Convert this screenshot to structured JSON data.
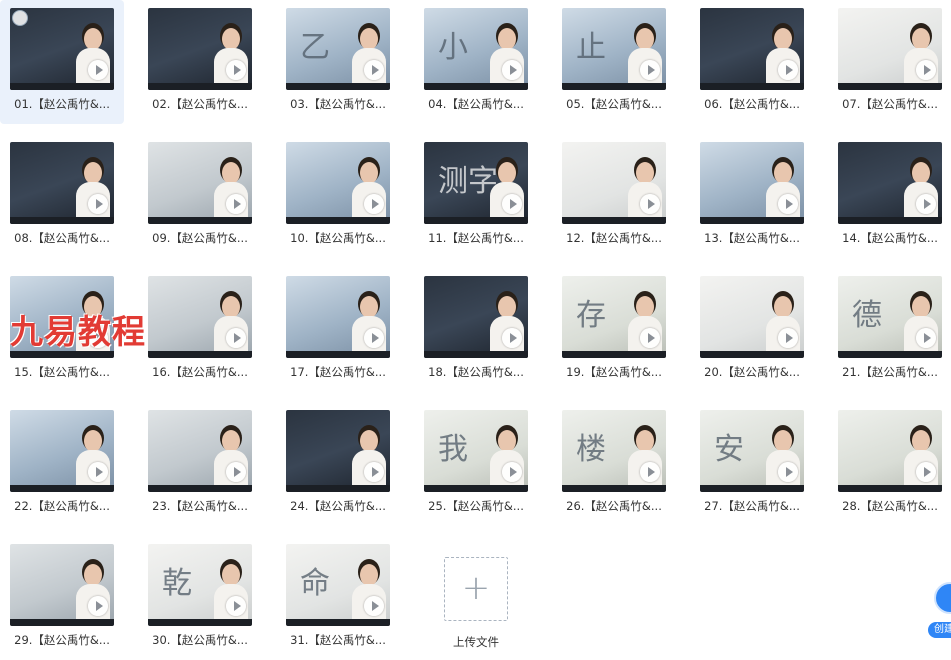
{
  "files": [
    {
      "label": "01.【赵公禹竹&...",
      "style": "dark",
      "glyph": "",
      "selected": true
    },
    {
      "label": "02.【赵公禹竹&...",
      "style": "dark",
      "glyph": ""
    },
    {
      "label": "03.【赵公禹竹&...",
      "style": "blue",
      "glyph": "乙"
    },
    {
      "label": "04.【赵公禹竹&...",
      "style": "blue",
      "glyph": "小"
    },
    {
      "label": "05.【赵公禹竹&...",
      "style": "blue",
      "glyph": "止"
    },
    {
      "label": "06.【赵公禹竹&...",
      "style": "dark",
      "glyph": ""
    },
    {
      "label": "07.【赵公禹竹&...",
      "style": "white",
      "glyph": ""
    },
    {
      "label": "08.【赵公禹竹&...",
      "style": "dark",
      "glyph": ""
    },
    {
      "label": "09.【赵公禹竹&...",
      "style": "grey",
      "glyph": ""
    },
    {
      "label": "10.【赵公禹竹&...",
      "style": "blue",
      "glyph": ""
    },
    {
      "label": "11.【赵公禹竹&...",
      "style": "dark",
      "glyph": "测字"
    },
    {
      "label": "12.【赵公禹竹&...",
      "style": "white",
      "glyph": ""
    },
    {
      "label": "13.【赵公禹竹&...",
      "style": "blue",
      "glyph": ""
    },
    {
      "label": "14.【赵公禹竹&...",
      "style": "dark",
      "glyph": ""
    },
    {
      "label": "15.【赵公禹竹&...",
      "style": "blue",
      "glyph": ""
    },
    {
      "label": "16.【赵公禹竹&...",
      "style": "grey",
      "glyph": ""
    },
    {
      "label": "17.【赵公禹竹&...",
      "style": "blue",
      "glyph": ""
    },
    {
      "label": "18.【赵公禹竹&...",
      "style": "dark",
      "glyph": ""
    },
    {
      "label": "19.【赵公禹竹&...",
      "style": "paper",
      "glyph": "存"
    },
    {
      "label": "20.【赵公禹竹&...",
      "style": "white",
      "glyph": ""
    },
    {
      "label": "21.【赵公禹竹&...",
      "style": "paper",
      "glyph": "德"
    },
    {
      "label": "22.【赵公禹竹&...",
      "style": "blue",
      "glyph": ""
    },
    {
      "label": "23.【赵公禹竹&...",
      "style": "grey",
      "glyph": ""
    },
    {
      "label": "24.【赵公禹竹&...",
      "style": "dark",
      "glyph": ""
    },
    {
      "label": "25.【赵公禹竹&...",
      "style": "paper",
      "glyph": "我"
    },
    {
      "label": "26.【赵公禹竹&...",
      "style": "paper",
      "glyph": "楼"
    },
    {
      "label": "27.【赵公禹竹&...",
      "style": "paper",
      "glyph": "安"
    },
    {
      "label": "28.【赵公禹竹&...",
      "style": "paper",
      "glyph": ""
    },
    {
      "label": "29.【赵公禹竹&...",
      "style": "grey",
      "glyph": ""
    },
    {
      "label": "30.【赵公禹竹&...",
      "style": "white",
      "glyph": "乾"
    },
    {
      "label": "31.【赵公禹竹&...",
      "style": "white",
      "glyph": "命"
    }
  ],
  "watermark": "九易教程",
  "upload": {
    "label": "上传文件",
    "icon": "plus-icon"
  },
  "floating": {
    "label": "创建",
    "icon": "float-assistant-icon"
  },
  "colors": {
    "accent": "#2f86f6",
    "watermark": "#e23b34",
    "selected_bg": "#eaf1fb"
  }
}
